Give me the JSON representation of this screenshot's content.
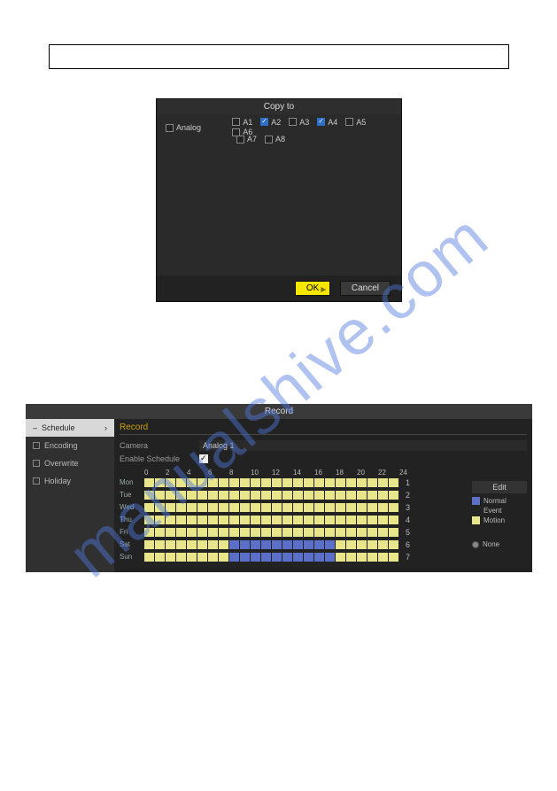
{
  "watermark": "manualshive.com",
  "copy_dialog": {
    "title": "Copy to",
    "analog_label": "Analog",
    "channels": [
      {
        "label": "A1",
        "checked": false
      },
      {
        "label": "A2",
        "checked": true
      },
      {
        "label": "A3",
        "checked": false
      },
      {
        "label": "A4",
        "checked": true
      },
      {
        "label": "A5",
        "checked": false
      },
      {
        "label": "A6",
        "checked": false
      },
      {
        "label": "A7",
        "checked": false
      },
      {
        "label": "A8",
        "checked": false
      }
    ],
    "ok_label": "OK",
    "cancel_label": "Cancel"
  },
  "record_panel": {
    "title": "Record",
    "sidebar": [
      {
        "label": "Schedule",
        "active": true
      },
      {
        "label": "Encoding",
        "active": false
      },
      {
        "label": "Overwrite",
        "active": false
      },
      {
        "label": "Holiday",
        "active": false
      }
    ],
    "tab_label": "Record",
    "camera_label": "Camera",
    "camera_value": "Analog 1",
    "enable_label": "Enable Schedule",
    "enable_checked": true,
    "hours": [
      "0",
      "2",
      "4",
      "6",
      "8",
      "10",
      "12",
      "14",
      "16",
      "18",
      "20",
      "22",
      "24"
    ],
    "days": [
      {
        "label": "Mon",
        "num": "1",
        "pattern": "mmmmmmmmmmmmmmmmmmmmmmmm"
      },
      {
        "label": "Tue",
        "num": "2",
        "pattern": "mmmmmmmmmmmmmmmmmmmmmmmm"
      },
      {
        "label": "Wed",
        "num": "3",
        "pattern": "mmmmmmmmmmmmmmmmmmmmmmmm"
      },
      {
        "label": "Thu",
        "num": "4",
        "pattern": "mmmmmmmmmmmmmmmmmmmmmmmm"
      },
      {
        "label": "Fri",
        "num": "5",
        "pattern": "mmmmmmmmmmmmmmmmmmmmmmmm"
      },
      {
        "label": "Sat",
        "num": "6",
        "pattern": "mmmmmmmmnnnnnnnnnnmmmmmm"
      },
      {
        "label": "Sun",
        "num": "7",
        "pattern": "mmmmmmmmnnnnnnnnnnmmmmmm"
      }
    ],
    "legend": {
      "edit_label": "Edit",
      "normal_label": "Normal",
      "event_label": "Event",
      "motion_label": "Motion",
      "none_label": "None"
    }
  }
}
